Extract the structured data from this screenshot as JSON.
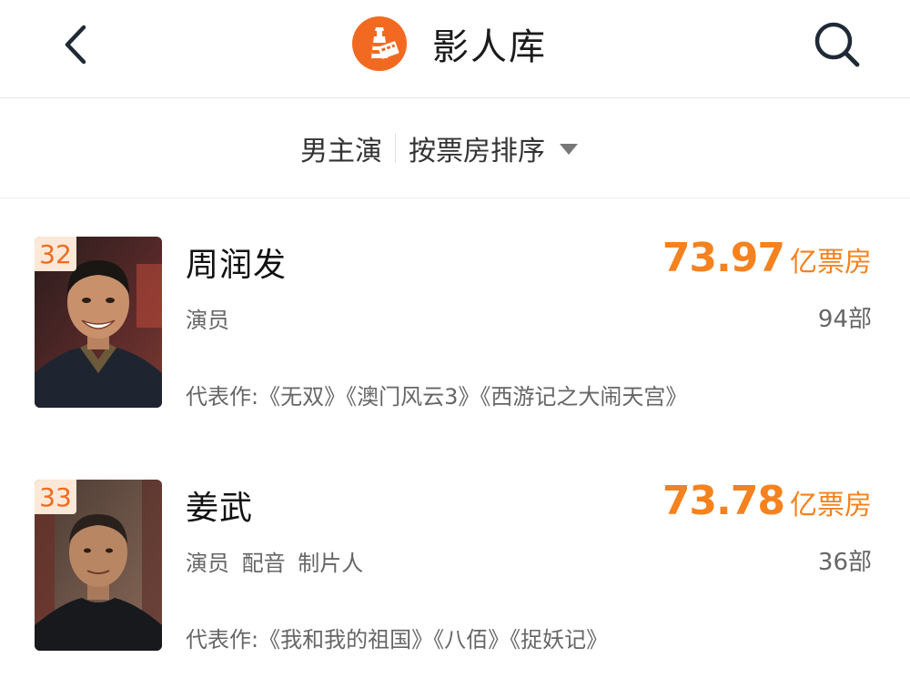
{
  "header": {
    "title": "影人库",
    "back_icon": "chevron-left-icon",
    "logo_icon": "lighthouse-logo-icon",
    "search_icon": "search-icon",
    "brand_color": "#f26a21"
  },
  "filters": {
    "category": "男主演",
    "sort": "按票房排序",
    "sort_caret_icon": "caret-down-icon"
  },
  "people": [
    {
      "rank": "32",
      "name": "周润发",
      "roles": "演员",
      "box_office_value": "73.97",
      "box_office_unit": "亿票房",
      "film_count": "94部",
      "works": "代表作:《无双》《澳门风云3》《西游记之大闹天宫》"
    },
    {
      "rank": "33",
      "name": "姜武",
      "roles": "演员 配音 制片人",
      "box_office_value": "73.78",
      "box_office_unit": "亿票房",
      "film_count": "36部",
      "works": "代表作:《我和我的祖国》《八佰》《捉妖记》"
    }
  ],
  "colors": {
    "accent": "#f5821f",
    "badge_bg": "#fbe8d6"
  }
}
